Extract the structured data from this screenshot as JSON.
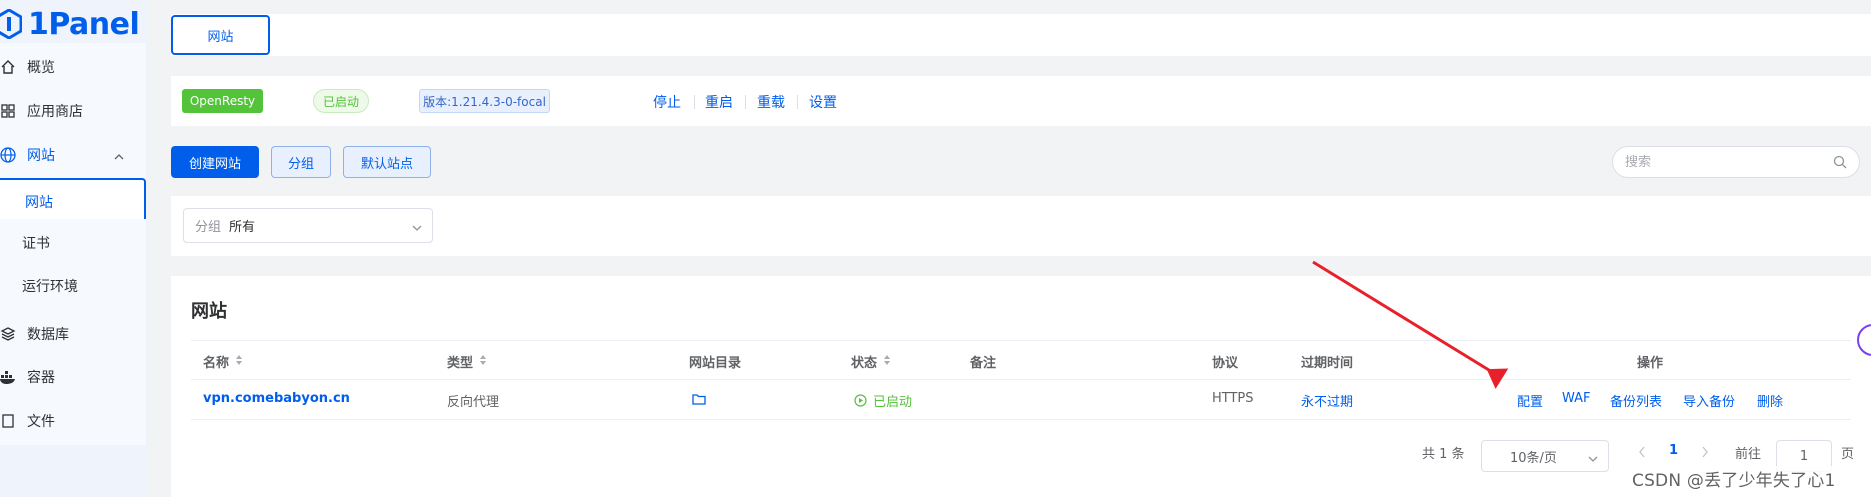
{
  "app": {
    "logo_text": "1Panel"
  },
  "sidebar": {
    "items": [
      {
        "label": "概览",
        "icon": "home-icon"
      },
      {
        "label": "应用商店",
        "icon": "grid-icon"
      },
      {
        "label": "网站",
        "icon": "globe-icon",
        "expanded": true
      },
      {
        "label": "网站",
        "sub": true,
        "active": true
      },
      {
        "label": "证书",
        "sub": true
      },
      {
        "label": "运行环境",
        "sub": true
      },
      {
        "label": "数据库",
        "icon": "layers-icon"
      },
      {
        "label": "容器",
        "icon": "docker-icon"
      },
      {
        "label": "文件",
        "icon": "file-icon"
      }
    ]
  },
  "tabs": {
    "active": "网站"
  },
  "openresty": {
    "name": "OpenResty",
    "status": "已启动",
    "version": "版本:1.21.4.3-0-focal",
    "actions": [
      "停止",
      "重启",
      "重载",
      "设置"
    ]
  },
  "toolbar": {
    "create_label": "创建网站",
    "group_label": "分组",
    "default_site_label": "默认站点",
    "search_placeholder": "搜索"
  },
  "filter": {
    "label": "分组",
    "value": "所有"
  },
  "section": {
    "title": "网站"
  },
  "table": {
    "headers": [
      "名称",
      "类型",
      "网站目录",
      "状态",
      "备注",
      "协议",
      "过期时间",
      "操作"
    ],
    "rows": [
      {
        "name": "vpn.comebabyon.cn",
        "type": "反向代理",
        "status": "已启动",
        "remark": "",
        "protocol": "HTTPS",
        "expire": "永不过期",
        "actions": [
          "配置",
          "WAF",
          "备份列表",
          "导入备份",
          "删除"
        ]
      }
    ]
  },
  "pagination": {
    "total": "共 1 条",
    "page_size": "10条/页",
    "current": "1",
    "goto_label": "前往",
    "goto_value": "1",
    "page_suffix": "页"
  },
  "watermark": "CSDN @丢了少年失了心1",
  "colors": {
    "primary": "#005eeb",
    "success": "#53c33a",
    "annotation_arrow": "#e8202a"
  }
}
